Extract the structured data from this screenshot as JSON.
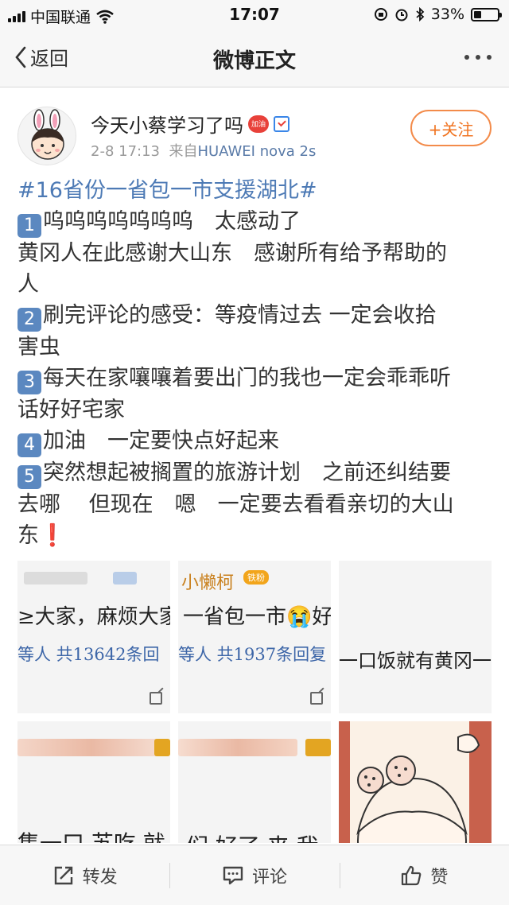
{
  "status_bar": {
    "carrier": "中国联通",
    "time": "17:07",
    "battery_text": "33%",
    "battery_level": 0.33
  },
  "nav": {
    "back_label": "返回",
    "title": "微博正文"
  },
  "post": {
    "username": "今天小蔡学习了吗",
    "heart_badge": "加油",
    "date": "2-8 17:13",
    "source_prefix": "来自",
    "source": "HUAWEI nova 2s",
    "follow_label": "+关注",
    "lines": [
      {
        "type": "topic",
        "text": "#16省份一省包一市支援湖北#"
      },
      {
        "type": "item",
        "num": "1",
        "text": "呜呜呜呜呜呜呜　太感动了"
      },
      {
        "type": "text",
        "text": "黄冈人在此感谢大山东　感谢所有给予帮助的"
      },
      {
        "type": "text",
        "text": "人"
      },
      {
        "type": "item",
        "num": "2",
        "text": "刷完评论的感受：等疫情过去 一定会收拾"
      },
      {
        "type": "text",
        "text": "害虫"
      },
      {
        "type": "item",
        "num": "3",
        "text": "每天在家嚷嚷着要出门的我也一定会乖乖听"
      },
      {
        "type": "text",
        "text": "话好好宅家"
      },
      {
        "type": "item",
        "num": "4",
        "text": "加油　一定要快点好起来"
      },
      {
        "type": "item",
        "num": "5",
        "text": "突然想起被搁置的旅游计划　之前还纠结要"
      },
      {
        "type": "text",
        "text": "去哪　 但现在　嗯　一定要去看看亲切的大山"
      },
      {
        "type": "end",
        "text": "东",
        "bang": "❗"
      }
    ]
  },
  "images": {
    "cell1": {
      "line1": "≥大家，麻烦大家",
      "line2": "等人 共13642条回"
    },
    "cell2": {
      "user": "小懒柯",
      "badge": "铁粉",
      "line1": "一省包一市😭好",
      "line2": "等人 共1937条回复"
    },
    "cell3": {
      "line1": "一口饭就有黄冈一"
    },
    "cell4": {
      "line1": "集一口 苏吃 就"
    },
    "cell5": {
      "line1": "们 好了 来 我"
    }
  },
  "toolbar": {
    "repost": "转发",
    "comment": "评论",
    "like": "赞"
  },
  "colors": {
    "link": "#4d7ab5",
    "follow": "#f07320",
    "keycap": "#5b88c0",
    "bang": "#e0211f"
  }
}
